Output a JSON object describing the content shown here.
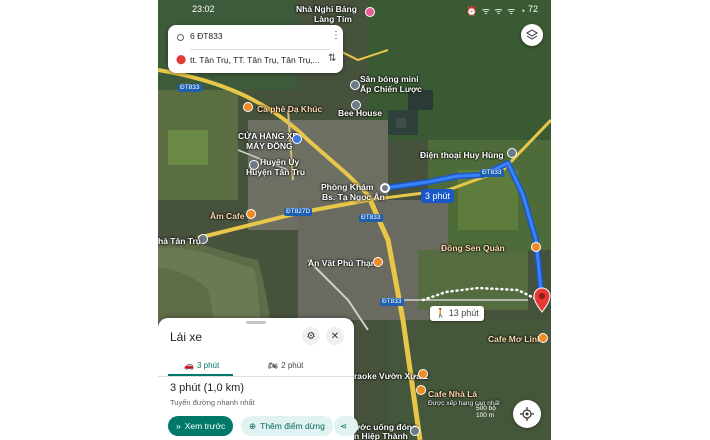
{
  "status_bar": {
    "time": "23:02",
    "battery": "72"
  },
  "search": {
    "origin": "6 ĐT833",
    "destination": "tt. Tân Trụ, TT. Tân Trụ, Tân Trụ,..."
  },
  "map_labels": {
    "nha_ngui": "Nhà Nghỉ Bảng",
    "lang_tim": "Làng Tím",
    "san_bong": "Sân bóng mini",
    "ap_chien": "Ấp Chiến Lược",
    "cafe_da_khuc": "Cà phê Dạ Khúc",
    "bee_house": "Bee House",
    "cua_hang_1": "CỬA HÀNG XE",
    "cua_hang_2": "MÁY ĐÔNG",
    "huyen_uy_1": "Huyện Ủy",
    "huyen_uy_2": "Huyện Tân Trụ",
    "dien_thoai": "Điện thoại Huy Hùng",
    "phong_kham_1": "Phòng Khám",
    "phong_kham_2": "Bs. Tạ Ngọc Ân",
    "am_cafe": "Âm Cafe",
    "nha_tan_tru": "hà Tân Trụ",
    "dong_sen": "Đồng Sen Quán",
    "an_vat": "Ăn Vặt Phú Thạnh",
    "cafe_mo_linh": "Cafe Mơ Linh",
    "karaoke": "raoke Vườn Xưa 2",
    "cafe_nha_la_1": "Cafe Nhà Lá",
    "cafe_nha_la_2": "Được xếp hạng cao nhất",
    "nuoc_uong_1": "ước uống đóng",
    "nuoc_uong_2": "n Hiệp Thành"
  },
  "road_tags": {
    "dt833_a": "ĐT833",
    "dt833_b": "ĐT833",
    "dt833_c": "ĐT833",
    "dt833_d": "ĐT833",
    "dt827d": "ĐT827D"
  },
  "route": {
    "drive_time": "3 phút",
    "walk_time": "13 phút"
  },
  "scale": {
    "label_1": "500 bộ",
    "label_2": "100 m"
  },
  "sheet": {
    "title": "Lái xe",
    "tab_car": "3 phút",
    "tab_moto": "2 phút",
    "duration": "3 phút (1,0 km)",
    "route_desc": "Tuyến đường nhanh nhất",
    "preview_label": "Xem trước",
    "add_stop_label": "Thêm điểm dừng"
  },
  "colors": {
    "route_blue": "#1a57c8",
    "accent_teal": "#00796b",
    "dest_red": "#e53935"
  }
}
